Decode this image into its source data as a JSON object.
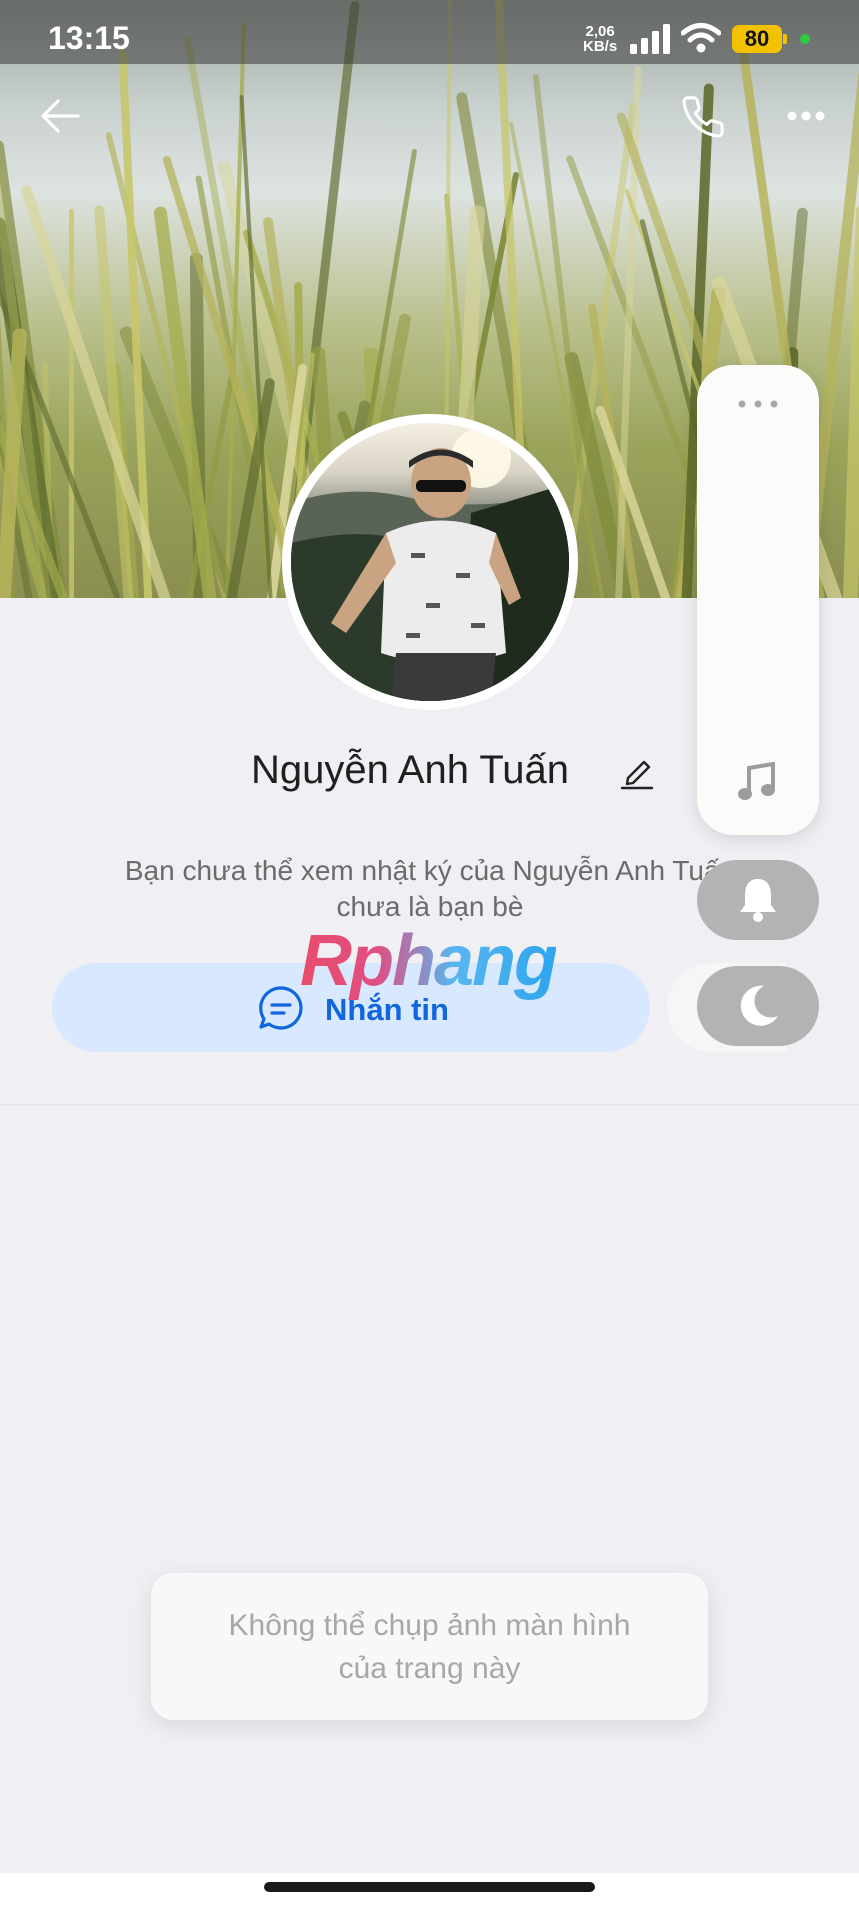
{
  "status_bar": {
    "time": "13:15",
    "speed_value": "2,06",
    "speed_unit": "KB/s",
    "battery": "80"
  },
  "header": {
    "back_icon": "arrow-left-icon",
    "call_icon": "phone-icon",
    "more_icon": "more-dots-icon"
  },
  "profile": {
    "name": "Nguyễn Anh Tuấn",
    "edit_icon": "pencil-icon",
    "diary_notice_line1": "Bạn chưa thể xem nhật ký của Nguyễn Anh Tuấn",
    "diary_notice_line2": "chưa là bạn bè",
    "message_button": "Nhắn tin"
  },
  "watermark": "Rphang",
  "side_panel": {
    "more_icon": "more-dots-icon",
    "music_icon": "music-note-icon",
    "bell_icon": "bell-icon",
    "moon_icon": "moon-icon"
  },
  "toast": {
    "line1": "Không thể chụp ảnh màn hình",
    "line2": "của trang này"
  },
  "colors": {
    "accent": "#1166e0",
    "button_bg": "#d8e9ff",
    "page_bg": "#efeff4"
  }
}
